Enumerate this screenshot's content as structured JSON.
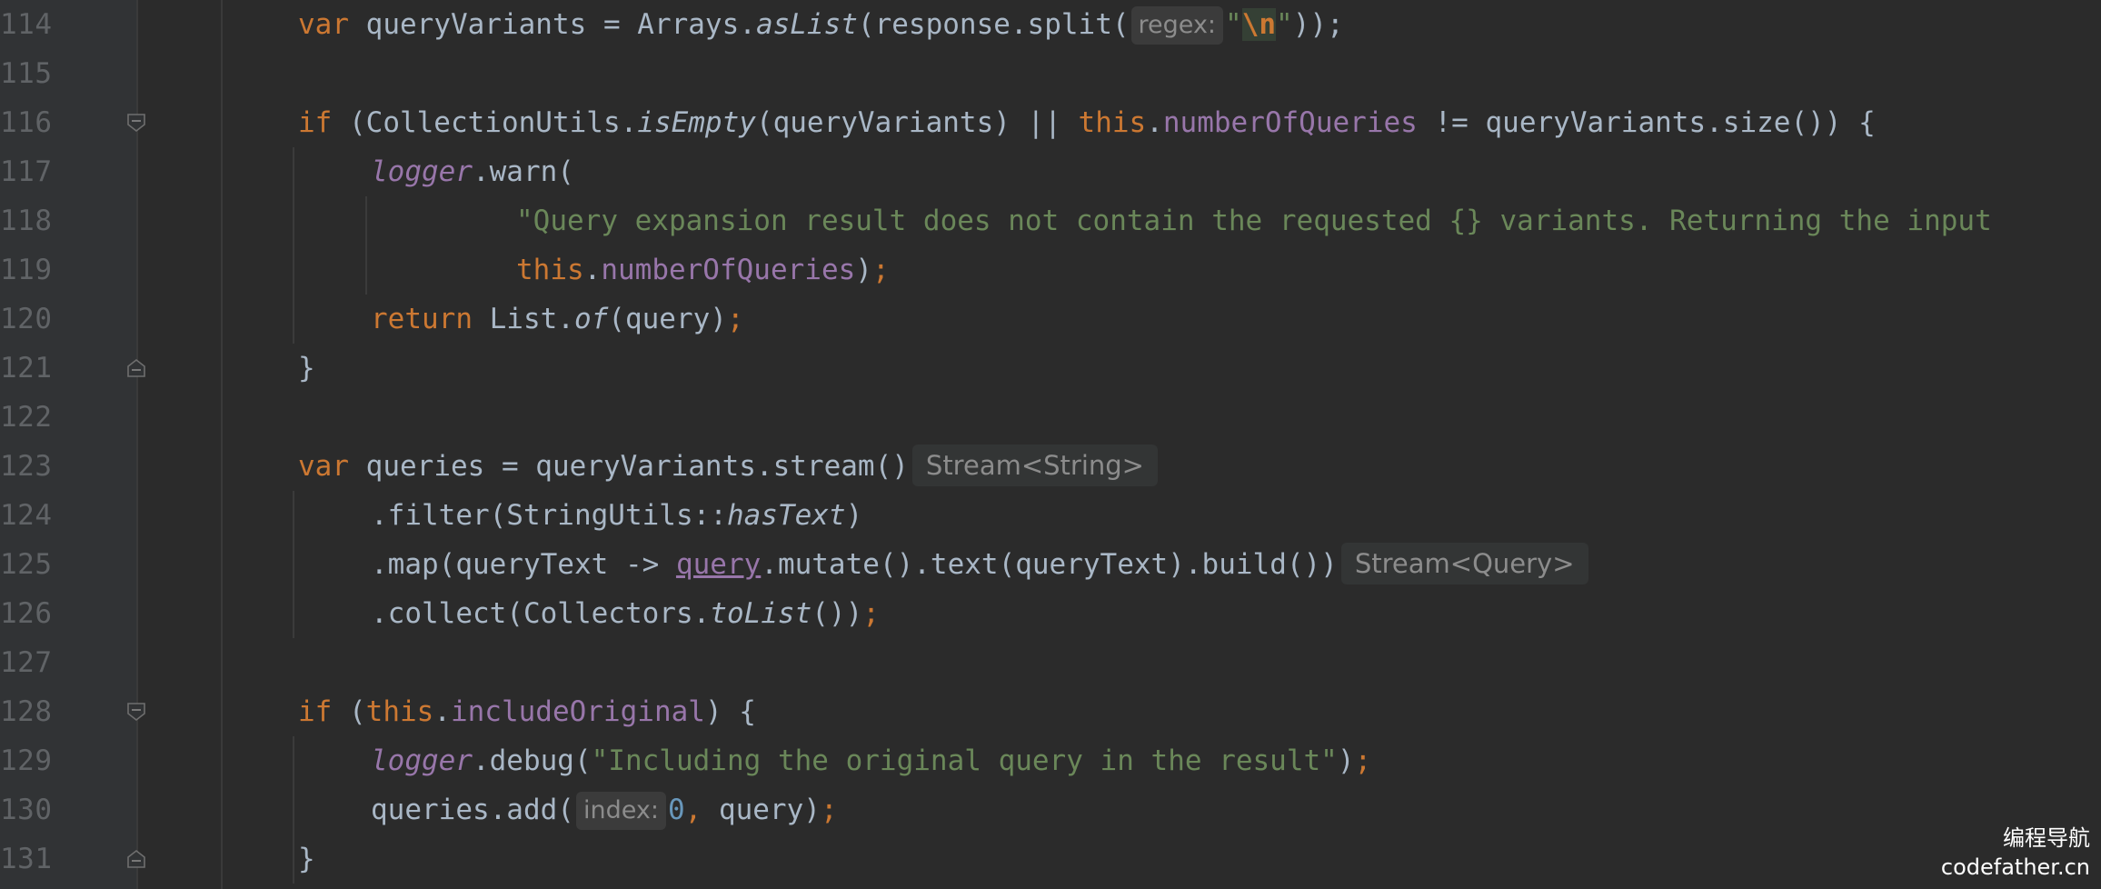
{
  "editor": {
    "theme_colors": {
      "background": "#2b2b2b",
      "keyword": "#cc7832",
      "field": "#9876aa",
      "string": "#6a8759",
      "number": "#6897bb",
      "default": "#a9b7c6",
      "line_number": "#606366"
    },
    "lines": [
      {
        "number": "114",
        "fold": ""
      },
      {
        "number": "115",
        "fold": ""
      },
      {
        "number": "116",
        "fold": "fold-open"
      },
      {
        "number": "117",
        "fold": ""
      },
      {
        "number": "118",
        "fold": ""
      },
      {
        "number": "119",
        "fold": ""
      },
      {
        "number": "120",
        "fold": ""
      },
      {
        "number": "121",
        "fold": "fold-close"
      },
      {
        "number": "122",
        "fold": ""
      },
      {
        "number": "123",
        "fold": ""
      },
      {
        "number": "124",
        "fold": ""
      },
      {
        "number": "125",
        "fold": ""
      },
      {
        "number": "126",
        "fold": ""
      },
      {
        "number": "127",
        "fold": ""
      },
      {
        "number": "128",
        "fold": "fold-open"
      },
      {
        "number": "129",
        "fold": ""
      },
      {
        "number": "130",
        "fold": ""
      },
      {
        "number": "131",
        "fold": "fold-close"
      }
    ],
    "code": {
      "l114": {
        "kw_var": "var",
        "t1": " queryVariants = Arrays.",
        "m_asList": "asList",
        "t2": "(response.split(",
        "hint_regex": "regex:",
        "q1": "\"",
        "esc_n": "\\n",
        "q2": "\"",
        "t3": "));"
      },
      "l116": {
        "kw_if": "if",
        "t1": " (CollectionUtils.",
        "m_isEmpty": "isEmpty",
        "t2": "(queryVariants) || ",
        "kw_this": "this",
        "dot": ".",
        "f_numberOfQueries": "numberOfQueries",
        "t3": " != queryVariants.size()) {"
      },
      "l117": {
        "f_logger": "logger",
        "t1": ".warn("
      },
      "l118": {
        "s1": "\"Query expansion result does not contain the requested {} variants. Returning the input"
      },
      "l119": {
        "kw_this": "this",
        "dot": ".",
        "f_numberOfQueries": "numberOfQueries",
        "t1": ")",
        "semi": ";"
      },
      "l120": {
        "kw_return": "return",
        "t1": " List.",
        "m_of": "of",
        "t2": "(query)",
        "semi": ";"
      },
      "l121": {
        "t1": "}"
      },
      "l123": {
        "kw_var": "var",
        "t1": " queries = queryVariants.stream()",
        "type_hint": "Stream<String>"
      },
      "l124": {
        "t1": ".filter(StringUtils::",
        "m_hasText": "hasText",
        "t2": ")"
      },
      "l125": {
        "t1": ".map(queryText -> ",
        "f_query": "query",
        "t2": ".mutate().text(queryText).build())",
        "type_hint": "Stream<Query>"
      },
      "l126": {
        "t1": ".collect(Collectors.",
        "m_toList": "toList",
        "t2": "())",
        "semi": ";"
      },
      "l128": {
        "kw_if": "if",
        "t1": " (",
        "kw_this": "this",
        "dot": ".",
        "f_includeOriginal": "includeOriginal",
        "t2": ") {"
      },
      "l129": {
        "f_logger": "logger",
        "t1": ".debug(",
        "s1": "\"Including the original query in the result\"",
        "t2": ")",
        "semi": ";"
      },
      "l130": {
        "t1": "queries.add(",
        "hint_index": "index:",
        "n0": "0",
        "comma": ",",
        "t2": " query)",
        "semi": ";"
      },
      "l131": {
        "t1": "}"
      }
    }
  },
  "watermark": {
    "line1": "编程导航",
    "line2": "codefather.cn"
  }
}
